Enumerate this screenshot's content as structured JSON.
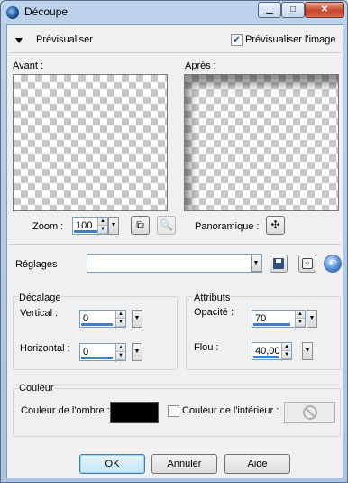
{
  "window": {
    "title": "Découpe"
  },
  "preview": {
    "label": "Prévisualiser",
    "show_image_label": "Prévisualiser l'image",
    "show_image_checked": true,
    "before_label": "Avant :",
    "after_label": "Après :",
    "zoom_label": "Zoom :",
    "zoom_value": "100",
    "pan_label": "Panoramique :"
  },
  "presets": {
    "label": "Réglages",
    "value": ""
  },
  "offset": {
    "title": "Décalage",
    "vertical_label": "Vertical :",
    "vertical_value": "0",
    "horizontal_label": "Horizontal :",
    "horizontal_value": "0"
  },
  "attributes": {
    "title": "Attributs",
    "opacity_label": "Opacité :",
    "opacity_value": "70",
    "blur_label": "Flou :",
    "blur_value": "40,00"
  },
  "color": {
    "title": "Couleur",
    "shadow_color_label": "Couleur de l'ombre :",
    "shadow_color": "#000000",
    "interior_label": "Couleur de l'intérieur :",
    "interior_checked": false
  },
  "buttons": {
    "ok": "OK",
    "cancel": "Annuler",
    "help": "Aide"
  }
}
